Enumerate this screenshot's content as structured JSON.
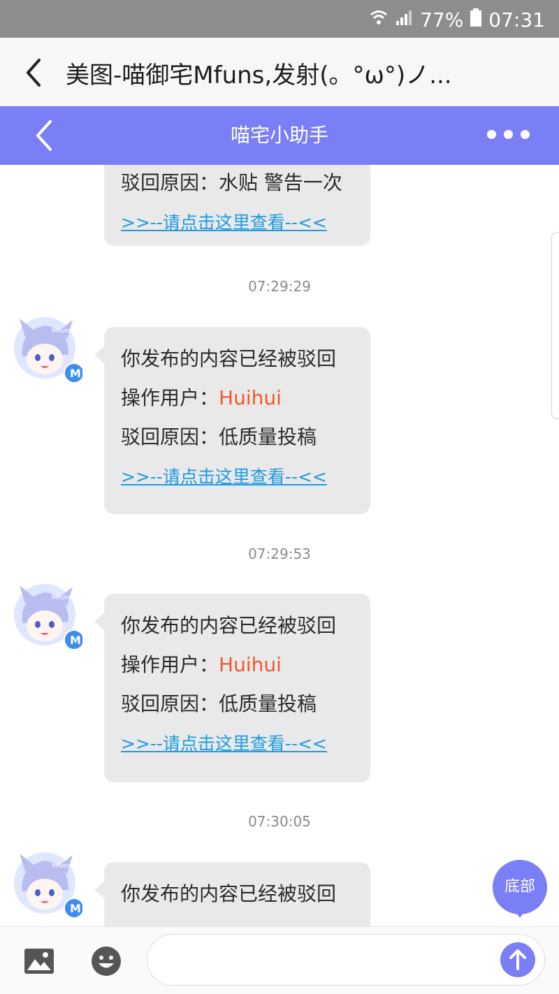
{
  "status_bar": {
    "battery": "77%",
    "time": "07:31"
  },
  "browser": {
    "title": "美图-喵御宅Mfuns,发射(。°ω°)ノ..."
  },
  "header": {
    "title": "喵宅小助手"
  },
  "messages": [
    {
      "reason": "驳回原因：水贴 警告一次",
      "link": ">>--请点击这里查看--<<"
    },
    {
      "timestamp": "07:29:29",
      "line1": "你发布的内容已经被驳回",
      "operator_label": "操作用户：",
      "operator": "Huihui",
      "reason": "驳回原因：低质量投稿",
      "link": ">>--请点击这里查看--<<"
    },
    {
      "timestamp": "07:29:53",
      "line1": "你发布的内容已经被驳回",
      "operator_label": "操作用户：",
      "operator": "Huihui",
      "reason": "驳回原因：低质量投稿",
      "link": ">>--请点击这里查看--<<"
    },
    {
      "timestamp": "07:30:05",
      "line1": "你发布的内容已经被驳回"
    }
  ],
  "avatar_label": "Mfuns",
  "avatar_badge": "M",
  "bottom_button": "底部",
  "input": {
    "placeholder": ""
  },
  "colors": {
    "accent": "#7b7ff5",
    "operator": "#f0582d",
    "link": "#1f9be0",
    "bubble": "#e9e9e9"
  }
}
